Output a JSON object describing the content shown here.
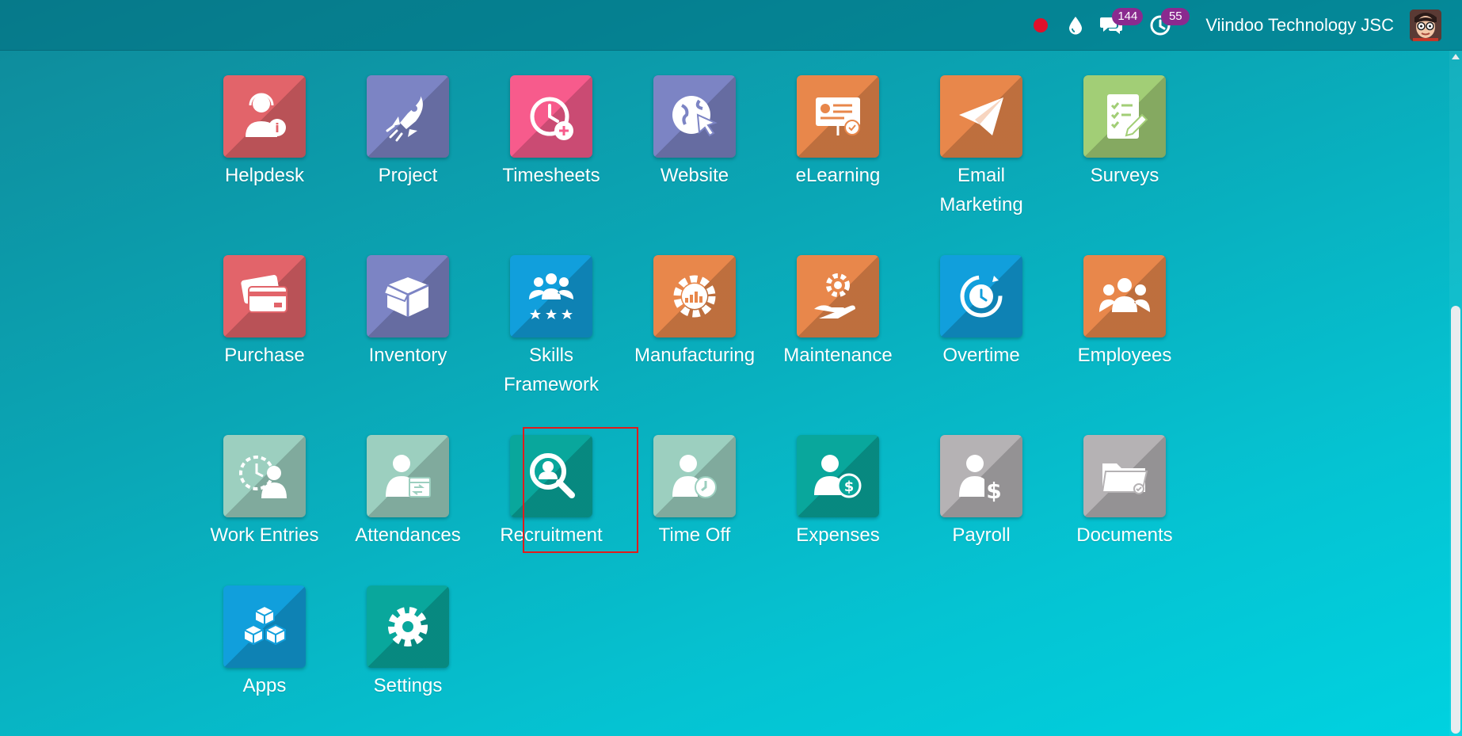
{
  "colors": {
    "red": "#e2646a",
    "purple": "#7c84c4",
    "pink": "#f75b8c",
    "orange": "#e8874b",
    "green": "#a2ce76",
    "blue": "#119fdc",
    "teal": "#09a79c",
    "mint": "#9ccfbf",
    "gray": "#b5b2b4",
    "highlight": "#e01c1c",
    "badge": "#8a2a8f"
  },
  "topbar": {
    "company": "Viindoo Technology JSC",
    "record_icon": "record-dot-icon",
    "drop_icon": "drop-icon",
    "messages_icon": "chat-icon",
    "messages_count": "144",
    "activities_icon": "clock-icon",
    "activities_count": "55",
    "avatar_icon": "user-avatar-icon"
  },
  "apps": [
    {
      "label": "Helpdesk",
      "icon": "helpdesk-icon",
      "color": "red"
    },
    {
      "label": "Project",
      "icon": "rocket-icon",
      "color": "purple"
    },
    {
      "label": "Timesheets",
      "icon": "timesheet-icon",
      "color": "pink"
    },
    {
      "label": "Website",
      "icon": "globe-cursor-icon",
      "color": "purple"
    },
    {
      "label": "eLearning",
      "icon": "presentation-icon",
      "color": "orange"
    },
    {
      "label": "Email Marketing",
      "icon": "paper-plane-icon",
      "color": "orange"
    },
    {
      "label": "Surveys",
      "icon": "clipboard-icon",
      "color": "green"
    },
    {
      "label": "Purchase",
      "icon": "credit-card-icon",
      "color": "red"
    },
    {
      "label": "Inventory",
      "icon": "box-icon",
      "color": "purple"
    },
    {
      "label": "Skills Framework",
      "icon": "team-stars-icon",
      "color": "blue"
    },
    {
      "label": "Manufacturing",
      "icon": "gear-chart-icon",
      "color": "orange"
    },
    {
      "label": "Maintenance",
      "icon": "hand-gear-icon",
      "color": "orange"
    },
    {
      "label": "Overtime",
      "icon": "clock-refresh-icon",
      "color": "blue"
    },
    {
      "label": "Employees",
      "icon": "group-icon",
      "color": "orange"
    },
    {
      "label": "Work Entries",
      "icon": "user-clock-icon",
      "color": "mint"
    },
    {
      "label": "Attendances",
      "icon": "user-calendar-icon",
      "color": "mint"
    },
    {
      "label": "Recruitment",
      "icon": "magnifier-user-icon",
      "color": "teal"
    },
    {
      "label": "Time Off",
      "icon": "user-time-icon",
      "color": "mint"
    },
    {
      "label": "Expenses",
      "icon": "user-dollar-icon",
      "color": "teal"
    },
    {
      "label": "Payroll",
      "icon": "user-payroll-icon",
      "color": "gray"
    },
    {
      "label": "Documents",
      "icon": "folder-icon",
      "color": "gray"
    },
    {
      "label": "Apps",
      "icon": "cubes-icon",
      "color": "blue"
    },
    {
      "label": "Settings",
      "icon": "gear-icon",
      "color": "teal"
    }
  ]
}
